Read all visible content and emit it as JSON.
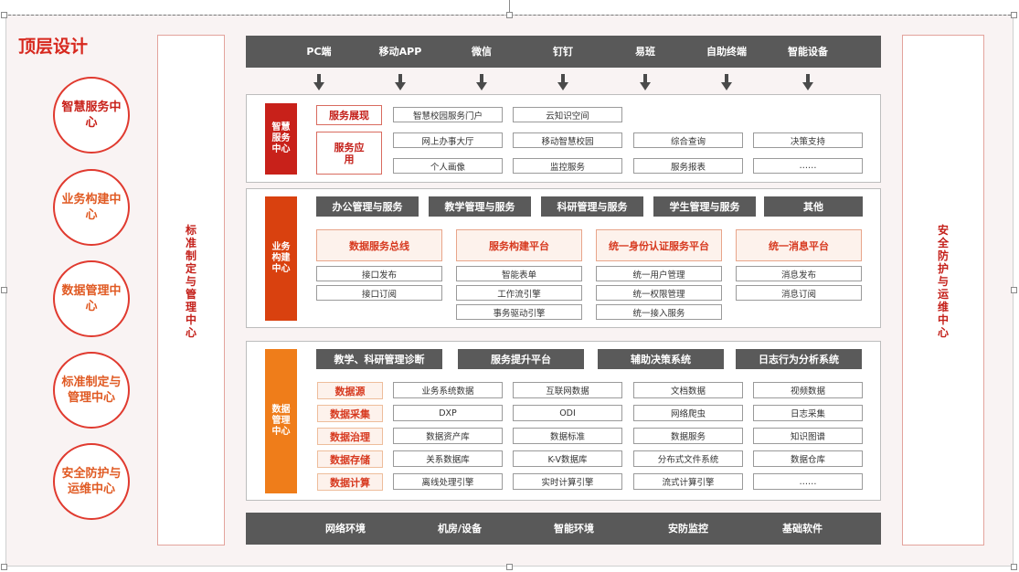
{
  "title": "顶层设计",
  "left_nav": [
    "智慧服务中心",
    "业务构建中心",
    "数据管理中心",
    "标准制定与管理中心",
    "安全防护与运维中心"
  ],
  "left_panel": "标准制定与管理中心",
  "right_panel": "安全防护与运维中心",
  "channels": [
    "PC端",
    "移动APP",
    "微信",
    "钉钉",
    "易班",
    "自助终端",
    "智能设备"
  ],
  "smart": {
    "label": "智慧服务中心",
    "display_label": "服务展现",
    "display_items": [
      "智慧校园服务门户",
      "云知识空间"
    ],
    "app_label": "服务应用",
    "app_row1": [
      "网上办事大厅",
      "移动智慧校园",
      "综合查询",
      "决策支持"
    ],
    "app_row2": [
      "个人画像",
      "监控服务",
      "服务报表",
      "……"
    ]
  },
  "business": {
    "label": "业务构建中心",
    "domains": [
      "办公管理与服务",
      "教学管理与服务",
      "科研管理与服务",
      "学生管理与服务",
      "其他"
    ],
    "platforms": [
      {
        "name": "数据服务总线",
        "items": [
          "接口发布",
          "接口订阅"
        ]
      },
      {
        "name": "服务构建平台",
        "items": [
          "智能表单",
          "工作流引擎",
          "事务驱动引擎"
        ]
      },
      {
        "name": "统一身份认证服务平台",
        "items": [
          "统一用户管理",
          "统一权限管理",
          "统一接入服务"
        ]
      },
      {
        "name": "统一消息平台",
        "items": [
          "消息发布",
          "消息订阅"
        ]
      }
    ]
  },
  "data": {
    "label": "数据管理中心",
    "apps": [
      "教学、科研管理诊断",
      "服务提升平台",
      "辅助决策系统",
      "日志行为分析系统"
    ],
    "rows": [
      {
        "name": "数据源",
        "items": [
          "业务系统数据",
          "互联网数据",
          "文档数据",
          "视频数据"
        ]
      },
      {
        "name": "数据采集",
        "items": [
          "DXP",
          "ODI",
          "网络爬虫",
          "日志采集"
        ]
      },
      {
        "name": "数据治理",
        "items": [
          "数据资产库",
          "数据标准",
          "数据服务",
          "知识图谱"
        ]
      },
      {
        "name": "数据存储",
        "items": [
          "关系数据库",
          "K-V数据库",
          "分布式文件系统",
          "数据仓库"
        ]
      },
      {
        "name": "数据计算",
        "items": [
          "离线处理引擎",
          "实时计算引擎",
          "流式计算引擎",
          "……"
        ]
      }
    ]
  },
  "infra": [
    "网络环境",
    "机房/设备",
    "智能环境",
    "安防监控",
    "基础软件"
  ],
  "colors": {
    "red": "#c8211a",
    "orange_red": "#d9410f",
    "orange": "#ef7d1a",
    "bar": "#595959",
    "accent_text": "#d7391f"
  }
}
